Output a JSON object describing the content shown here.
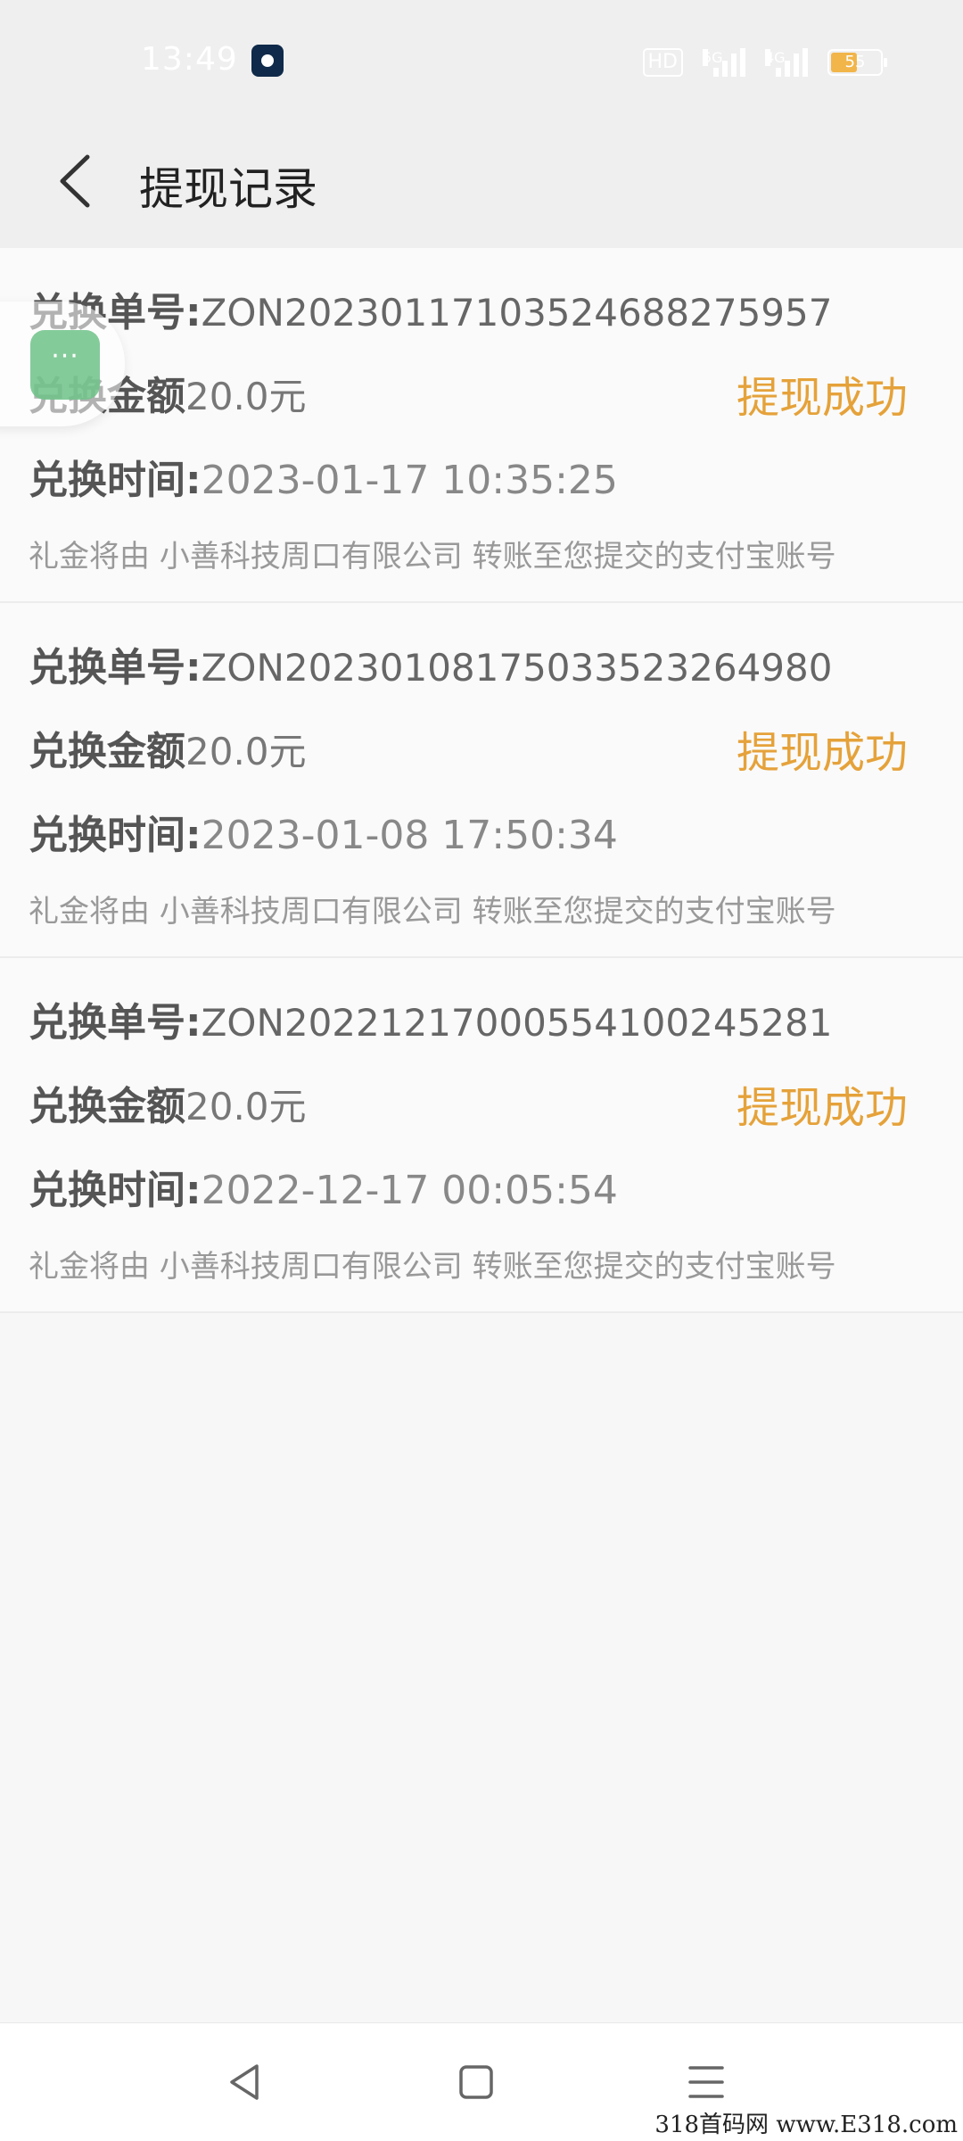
{
  "status_bar": {
    "time": "13:49",
    "hd_badge": "HD",
    "signal1_label": "5G",
    "signal2_label": "4G",
    "battery_level": "55"
  },
  "header": {
    "title": "提现记录"
  },
  "records": [
    {
      "order_label": "兑换单号:",
      "order_no": "ZON20230117103524688275957",
      "amount_label": "兑换金额",
      "amount": "20.0元",
      "status": "提现成功",
      "time_label": "兑换时间:",
      "time": "2023-01-17 10:35:25",
      "note": "礼金将由 小善科技周口有限公司 转账至您提交的支付宝账号"
    },
    {
      "order_label": "兑换单号:",
      "order_no": "ZON20230108175033523264980",
      "amount_label": "兑换金额",
      "amount": "20.0元",
      "status": "提现成功",
      "time_label": "兑换时间:",
      "time": "2023-01-08 17:50:34",
      "note": "礼金将由 小善科技周口有限公司 转账至您提交的支付宝账号"
    },
    {
      "order_label": "兑换单号:",
      "order_no": "ZON20221217000554100245281",
      "amount_label": "兑换金额",
      "amount": "20.0元",
      "status": "提现成功",
      "time_label": "兑换时间:",
      "time": "2022-12-17 00:05:54",
      "note": "礼金将由 小善科技周口有限公司 转账至您提交的支付宝账号"
    }
  ],
  "floating_button": {
    "label": "···"
  },
  "colors": {
    "status_success": "#e5a23a",
    "header_bg": "#efefef",
    "page_bg": "#f7f7f7"
  },
  "watermark": "318首码网 www.E318.com"
}
